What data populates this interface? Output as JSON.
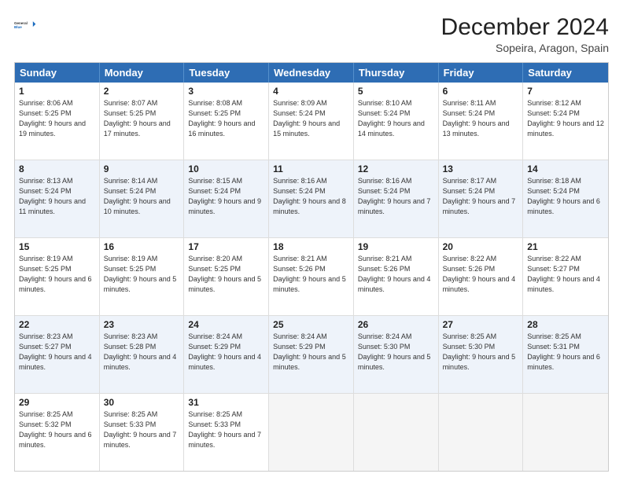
{
  "header": {
    "logo_general": "General",
    "logo_blue": "Blue",
    "month_title": "December 2024",
    "location": "Sopeira, Aragon, Spain"
  },
  "weekdays": [
    "Sunday",
    "Monday",
    "Tuesday",
    "Wednesday",
    "Thursday",
    "Friday",
    "Saturday"
  ],
  "rows": [
    {
      "alt": false,
      "cells": [
        {
          "day": "1",
          "sunrise": "8:06 AM",
          "sunset": "5:25 PM",
          "daylight_hours": "9",
          "daylight_mins": "19"
        },
        {
          "day": "2",
          "sunrise": "8:07 AM",
          "sunset": "5:25 PM",
          "daylight_hours": "9",
          "daylight_mins": "17"
        },
        {
          "day": "3",
          "sunrise": "8:08 AM",
          "sunset": "5:25 PM",
          "daylight_hours": "9",
          "daylight_mins": "16"
        },
        {
          "day": "4",
          "sunrise": "8:09 AM",
          "sunset": "5:24 PM",
          "daylight_hours": "9",
          "daylight_mins": "15"
        },
        {
          "day": "5",
          "sunrise": "8:10 AM",
          "sunset": "5:24 PM",
          "daylight_hours": "9",
          "daylight_mins": "14"
        },
        {
          "day": "6",
          "sunrise": "8:11 AM",
          "sunset": "5:24 PM",
          "daylight_hours": "9",
          "daylight_mins": "13"
        },
        {
          "day": "7",
          "sunrise": "8:12 AM",
          "sunset": "5:24 PM",
          "daylight_hours": "9",
          "daylight_mins": "12"
        }
      ]
    },
    {
      "alt": true,
      "cells": [
        {
          "day": "8",
          "sunrise": "8:13 AM",
          "sunset": "5:24 PM",
          "daylight_hours": "9",
          "daylight_mins": "11"
        },
        {
          "day": "9",
          "sunrise": "8:14 AM",
          "sunset": "5:24 PM",
          "daylight_hours": "9",
          "daylight_mins": "10"
        },
        {
          "day": "10",
          "sunrise": "8:15 AM",
          "sunset": "5:24 PM",
          "daylight_hours": "9",
          "daylight_mins": "9"
        },
        {
          "day": "11",
          "sunrise": "8:16 AM",
          "sunset": "5:24 PM",
          "daylight_hours": "9",
          "daylight_mins": "8"
        },
        {
          "day": "12",
          "sunrise": "8:16 AM",
          "sunset": "5:24 PM",
          "daylight_hours": "9",
          "daylight_mins": "7"
        },
        {
          "day": "13",
          "sunrise": "8:17 AM",
          "sunset": "5:24 PM",
          "daylight_hours": "9",
          "daylight_mins": "7"
        },
        {
          "day": "14",
          "sunrise": "8:18 AM",
          "sunset": "5:24 PM",
          "daylight_hours": "9",
          "daylight_mins": "6"
        }
      ]
    },
    {
      "alt": false,
      "cells": [
        {
          "day": "15",
          "sunrise": "8:19 AM",
          "sunset": "5:25 PM",
          "daylight_hours": "9",
          "daylight_mins": "6"
        },
        {
          "day": "16",
          "sunrise": "8:19 AM",
          "sunset": "5:25 PM",
          "daylight_hours": "9",
          "daylight_mins": "5"
        },
        {
          "day": "17",
          "sunrise": "8:20 AM",
          "sunset": "5:25 PM",
          "daylight_hours": "9",
          "daylight_mins": "5"
        },
        {
          "day": "18",
          "sunrise": "8:21 AM",
          "sunset": "5:26 PM",
          "daylight_hours": "9",
          "daylight_mins": "5"
        },
        {
          "day": "19",
          "sunrise": "8:21 AM",
          "sunset": "5:26 PM",
          "daylight_hours": "9",
          "daylight_mins": "4"
        },
        {
          "day": "20",
          "sunrise": "8:22 AM",
          "sunset": "5:26 PM",
          "daylight_hours": "9",
          "daylight_mins": "4"
        },
        {
          "day": "21",
          "sunrise": "8:22 AM",
          "sunset": "5:27 PM",
          "daylight_hours": "9",
          "daylight_mins": "4"
        }
      ]
    },
    {
      "alt": true,
      "cells": [
        {
          "day": "22",
          "sunrise": "8:23 AM",
          "sunset": "5:27 PM",
          "daylight_hours": "9",
          "daylight_mins": "4"
        },
        {
          "day": "23",
          "sunrise": "8:23 AM",
          "sunset": "5:28 PM",
          "daylight_hours": "9",
          "daylight_mins": "4"
        },
        {
          "day": "24",
          "sunrise": "8:24 AM",
          "sunset": "5:29 PM",
          "daylight_hours": "9",
          "daylight_mins": "4"
        },
        {
          "day": "25",
          "sunrise": "8:24 AM",
          "sunset": "5:29 PM",
          "daylight_hours": "9",
          "daylight_mins": "5"
        },
        {
          "day": "26",
          "sunrise": "8:24 AM",
          "sunset": "5:30 PM",
          "daylight_hours": "9",
          "daylight_mins": "5"
        },
        {
          "day": "27",
          "sunrise": "8:25 AM",
          "sunset": "5:30 PM",
          "daylight_hours": "9",
          "daylight_mins": "5"
        },
        {
          "day": "28",
          "sunrise": "8:25 AM",
          "sunset": "5:31 PM",
          "daylight_hours": "9",
          "daylight_mins": "6"
        }
      ]
    },
    {
      "alt": false,
      "cells": [
        {
          "day": "29",
          "sunrise": "8:25 AM",
          "sunset": "5:32 PM",
          "daylight_hours": "9",
          "daylight_mins": "6"
        },
        {
          "day": "30",
          "sunrise": "8:25 AM",
          "sunset": "5:33 PM",
          "daylight_hours": "9",
          "daylight_mins": "7"
        },
        {
          "day": "31",
          "sunrise": "8:25 AM",
          "sunset": "5:33 PM",
          "daylight_hours": "9",
          "daylight_mins": "7"
        },
        {
          "day": "",
          "sunrise": "",
          "sunset": "",
          "daylight_hours": "",
          "daylight_mins": ""
        },
        {
          "day": "",
          "sunrise": "",
          "sunset": "",
          "daylight_hours": "",
          "daylight_mins": ""
        },
        {
          "day": "",
          "sunrise": "",
          "sunset": "",
          "daylight_hours": "",
          "daylight_mins": ""
        },
        {
          "day": "",
          "sunrise": "",
          "sunset": "",
          "daylight_hours": "",
          "daylight_mins": ""
        }
      ]
    }
  ],
  "labels": {
    "sunrise": "Sunrise:",
    "sunset": "Sunset:",
    "daylight": "Daylight:",
    "hours_suffix": "hours",
    "and": "and",
    "minutes_suffix": "minutes."
  }
}
